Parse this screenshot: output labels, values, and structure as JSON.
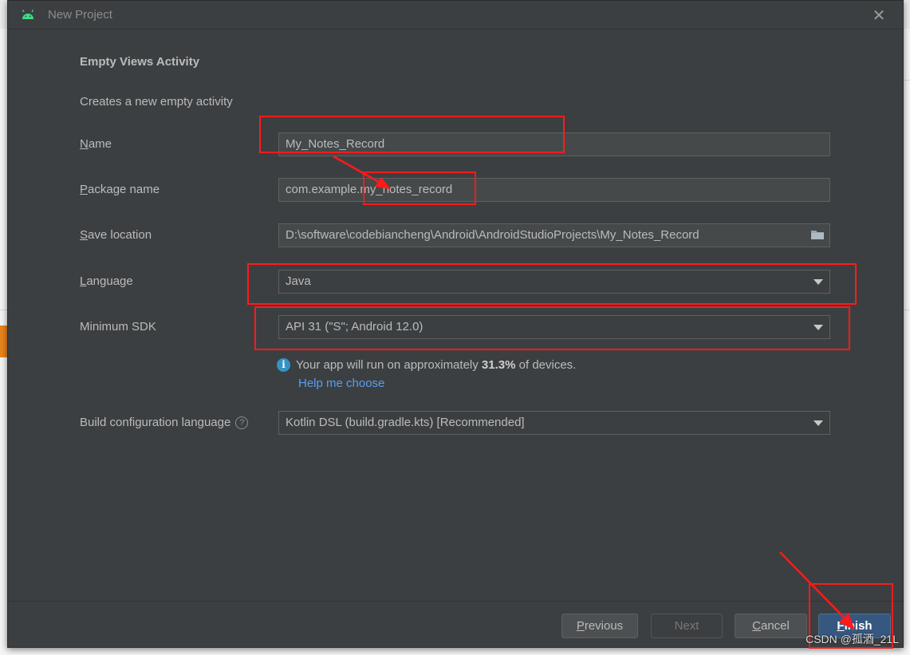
{
  "window": {
    "title": "New Project"
  },
  "form": {
    "heading": "Empty Views Activity",
    "description": "Creates a new empty activity",
    "name": {
      "label_mnemonic": "N",
      "label_rest": "ame",
      "value": "My_Notes_Record"
    },
    "package": {
      "label_mnemonic": "P",
      "label_rest": "ackage name",
      "value": "com.example.my_notes_record"
    },
    "save_location": {
      "label_mnemonic": "S",
      "label_rest": "ave location",
      "value": "D:\\software\\codebiancheng\\Android\\AndroidStudioProjects\\My_Notes_Record"
    },
    "language": {
      "label_mnemonic": "L",
      "label_rest": "anguage",
      "value": "Java"
    },
    "min_sdk": {
      "label": "Minimum SDK",
      "value": "API 31 (\"S\"; Android 12.0)"
    },
    "info": {
      "prefix": "Your app will run on approximately ",
      "percent": "31.3%",
      "suffix": " of devices.",
      "help_link": "Help me choose"
    },
    "build_config": {
      "label": "Build configuration language",
      "help_icon": "?",
      "value": "Kotlin DSL (build.gradle.kts) [Recommended]"
    }
  },
  "buttons": {
    "previous": {
      "mnemonic": "P",
      "rest": "revious"
    },
    "next": "Next",
    "cancel": {
      "mnemonic": "C",
      "rest": "ancel"
    },
    "finish": {
      "mnemonic": "F",
      "rest": "inish"
    }
  },
  "watermark": "CSDN @孤酒_21L",
  "colors": {
    "dialog_bg": "#3c3f41",
    "field_bg": "#45494a",
    "link": "#589df6",
    "primary_button": "#365880",
    "annotation": "#ff1a1a"
  },
  "icons": {
    "app": "android-icon",
    "close": "close-icon",
    "folder": "folder-icon",
    "dropdown": "chevron-down-icon",
    "info": "info-icon",
    "help": "question-icon"
  }
}
